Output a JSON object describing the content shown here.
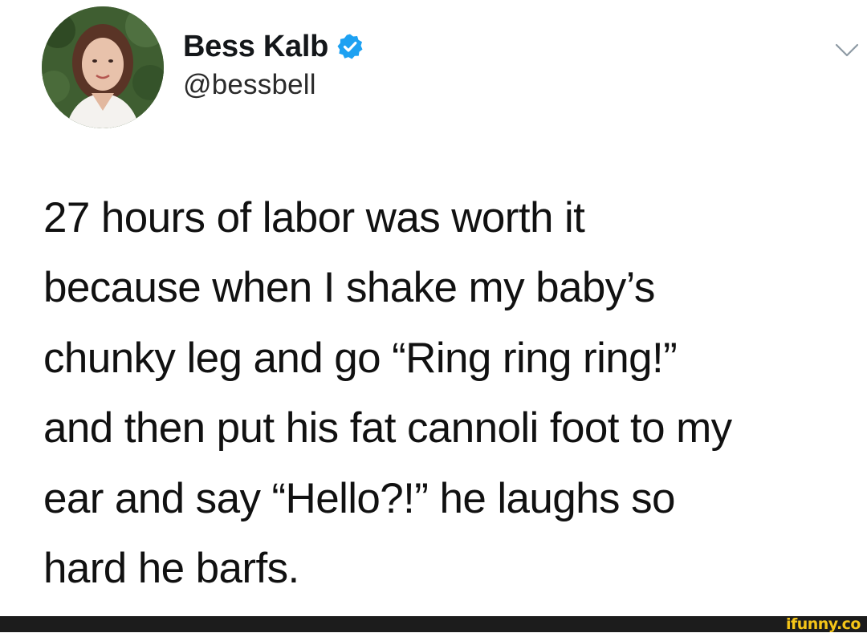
{
  "tweet": {
    "author": {
      "display_name": "Bess Kalb",
      "handle": "@bessbell",
      "verified": true,
      "avatar_icon": "profile-photo"
    },
    "menu_icon": "chevron-down-icon",
    "text_lines": [
      "27 hours of labor was worth it",
      "because when I shake my baby’s",
      "chunky leg and go “Ring ring ring!”",
      "and then put his fat cannoli foot to my",
      "ear and say “Hello?!” he laughs so",
      "hard he barfs."
    ]
  },
  "watermark": {
    "text": "ifunny.co"
  },
  "colors": {
    "verified_badge": "#1da1f2",
    "footer_bar": "#1c1c1c",
    "watermark": "#f5c518"
  }
}
